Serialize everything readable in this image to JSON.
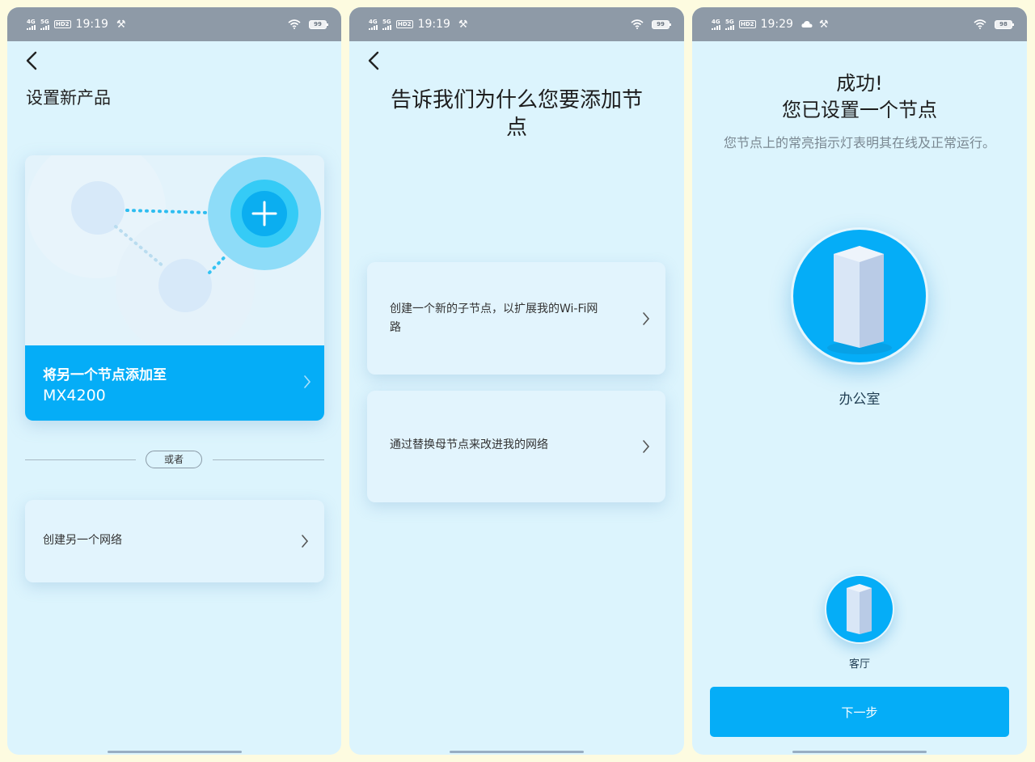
{
  "screens": [
    {
      "status": {
        "net1": "4G",
        "net2": "5G",
        "hd": "HD2",
        "time": "19:19",
        "battery": "99"
      },
      "title": "设置新产品",
      "add_card": {
        "line1": "将另一个节点添加至",
        "line2": "MX4200"
      },
      "or_label": "或者",
      "create_network": "创建另一个网络"
    },
    {
      "status": {
        "net1": "4G",
        "net2": "5G",
        "hd": "HD2",
        "time": "19:19",
        "battery": "99"
      },
      "title": "告诉我们为什么您要添加节点",
      "option1": "创建一个新的子节点，以扩展我的Wi-Fi网路",
      "option2": "通过替换母节点来改进我的网络"
    },
    {
      "status": {
        "net1": "4G",
        "net2": "5G",
        "hd": "HD2",
        "time": "19:29",
        "battery": "98"
      },
      "title_line1": "成功!",
      "title_line2": "您已设置一个节点",
      "subtitle": "您节点上的常亮指示灯表明其在线及正常运行。",
      "node_main": "办公室",
      "node_secondary": "客厅",
      "next_button": "下一步"
    }
  ],
  "colors": {
    "screen_bg": "#dcf4fd",
    "status_bar": "#8e9aa7",
    "accent": "#05adf7",
    "page_bg": "#fdfbe0"
  },
  "icons": [
    "back-arrow-icon",
    "chevron-right-icon",
    "plus-icon",
    "wifi-icon",
    "battery-icon",
    "tools-icon",
    "cloud-icon",
    "router-node-icon"
  ]
}
